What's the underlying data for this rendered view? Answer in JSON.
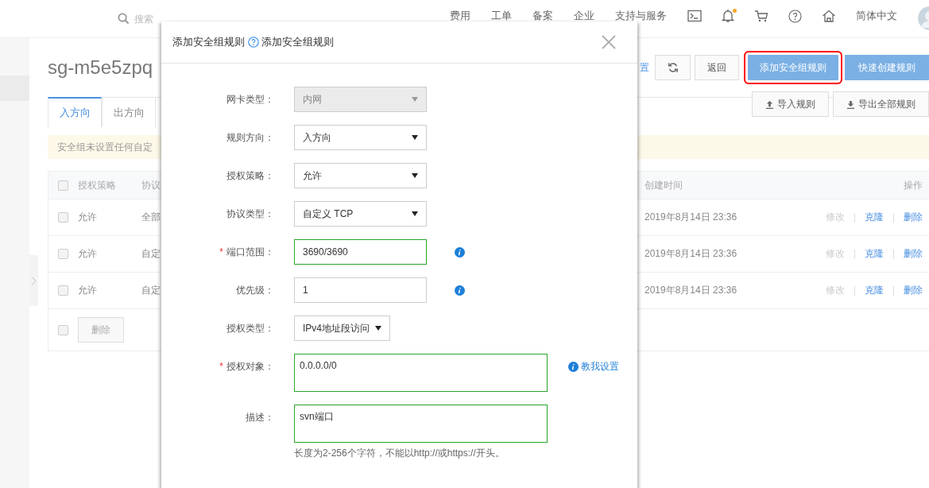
{
  "topbar": {
    "search_placeholder": "搜索",
    "nav": [
      "费用",
      "工单",
      "备案",
      "企业",
      "支持与服务"
    ],
    "notification_dot": true,
    "language": "简体中文"
  },
  "page": {
    "title": "sg-m5e5zpq",
    "toolbar": {
      "settings_link": "置",
      "back": "返回",
      "add_rule": "添加安全组规则",
      "add_rule_highlighted": true,
      "quick_create": "快速创建规则",
      "import": "导入规则",
      "export": "导出全部规则"
    },
    "tabs": [
      {
        "label": "入方向",
        "selected": true
      },
      {
        "label": "出方向",
        "selected": false
      }
    ],
    "notice": "安全组未设置任何自定",
    "table": {
      "columns": [
        "授权策略",
        "协议",
        "创建时间",
        "操作"
      ],
      "header_checked": false,
      "rows": [
        {
          "checked": false,
          "policy": "允许",
          "protocol": "全部",
          "created": "2019年8月14日 23:36",
          "actions": [
            {
              "label": "修改",
              "disabled": true
            },
            {
              "label": "克隆",
              "disabled": false
            },
            {
              "label": "删除",
              "disabled": false
            }
          ]
        },
        {
          "checked": false,
          "policy": "允许",
          "protocol": "自定",
          "created": "2019年8月14日 23:36",
          "actions": [
            {
              "label": "修改",
              "disabled": true
            },
            {
              "label": "克隆",
              "disabled": false
            },
            {
              "label": "删除",
              "disabled": false
            }
          ]
        },
        {
          "checked": false,
          "policy": "允许",
          "protocol": "自定",
          "created": "2019年8月14日 23:36",
          "actions": [
            {
              "label": "修改",
              "disabled": true
            },
            {
              "label": "克隆",
              "disabled": false
            },
            {
              "label": "删除",
              "disabled": false
            }
          ]
        }
      ],
      "footer_checked": false,
      "delete_button": {
        "label": "删除",
        "disabled": true
      }
    }
  },
  "dialog": {
    "title": "添加安全组规则",
    "help_text": "添加安全组规则",
    "fields": [
      {
        "label": "网卡类型：",
        "kind": "select",
        "value": "内网",
        "disabled": true,
        "valid": false,
        "info": false
      },
      {
        "label": "规则方向：",
        "kind": "select",
        "value": "入方向",
        "disabled": false,
        "valid": false,
        "info": false
      },
      {
        "label": "授权策略：",
        "kind": "select",
        "value": "允许",
        "disabled": false,
        "valid": false,
        "info": false
      },
      {
        "label": "协议类型：",
        "kind": "select",
        "value": "自定义 TCP",
        "disabled": false,
        "valid": false,
        "info": false
      },
      {
        "label": "端口范围：",
        "required_mark": "*",
        "kind": "input",
        "value": "3690/3690",
        "disabled": false,
        "valid": true,
        "info": true
      },
      {
        "label": "优先级：",
        "kind": "input",
        "value": "1",
        "disabled": false,
        "valid": false,
        "info": true
      },
      {
        "label": "授权类型：",
        "kind": "select",
        "value": "IPv4地址段访问",
        "disabled": false,
        "valid": false,
        "info": false
      },
      {
        "label": "授权对象：",
        "required_mark": "*",
        "kind": "textarea",
        "value": "0.0.0.0/0",
        "disabled": false,
        "valid": true,
        "info": false,
        "link": "教我设置"
      },
      {
        "label": "描述：",
        "kind": "textarea",
        "value": "svn端口",
        "disabled": false,
        "valid": true,
        "info": false,
        "hint": "长度为2-256个字符，不能以http://或https://开头。"
      }
    ]
  }
}
